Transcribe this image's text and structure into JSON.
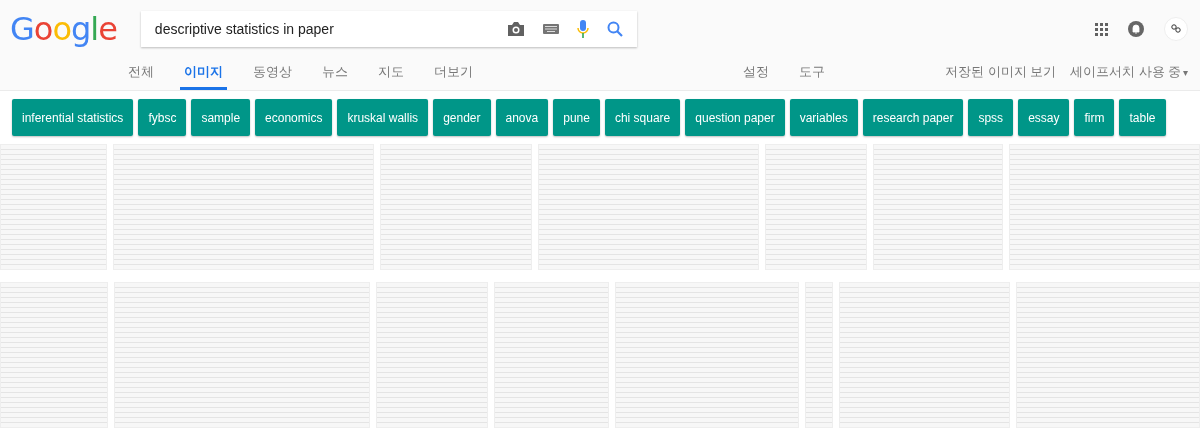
{
  "logo": "Google",
  "search": {
    "value": "descriptive statistics in paper"
  },
  "tabs": [
    {
      "label": "전체",
      "selected": false
    },
    {
      "label": "이미지",
      "selected": true
    },
    {
      "label": "동영상",
      "selected": false
    },
    {
      "label": "뉴스",
      "selected": false
    },
    {
      "label": "지도",
      "selected": false
    },
    {
      "label": "더보기",
      "selected": false
    }
  ],
  "tools": [
    "설정",
    "도구"
  ],
  "right_links": {
    "saved": "저장된 이미지 보기",
    "safesearch": "세이프서치 사용 중",
    "safesearch_caret": "▾"
  },
  "chips": [
    "inferential statistics",
    "fybsc",
    "sample",
    "economics",
    "kruskal wallis",
    "gender",
    "anova",
    "pune",
    "chi square",
    "question paper",
    "variables",
    "research paper",
    "spss",
    "essay",
    "firm",
    "table"
  ]
}
